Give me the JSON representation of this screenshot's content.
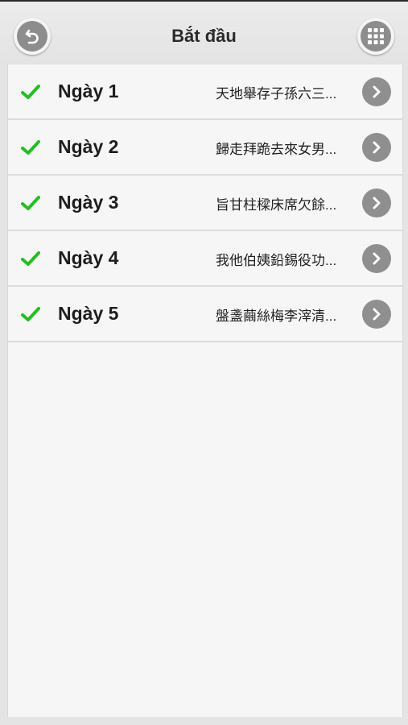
{
  "header": {
    "title": "Bắt đầu",
    "back_icon": "undo-arrow-icon",
    "menu_icon": "grid-icon"
  },
  "colors": {
    "check": "#22c022",
    "chevron_bg": "#8f8f8f"
  },
  "days": [
    {
      "label": "Ngày 1",
      "preview": "天地舉存子孫六三...",
      "completed": true
    },
    {
      "label": "Ngày 2",
      "preview": "歸走拜跪去來女男...",
      "completed": true
    },
    {
      "label": "Ngày 3",
      "preview": "旨甘柱樑床席欠餘...",
      "completed": true
    },
    {
      "label": "Ngày 4",
      "preview": "我他伯姨鉛錫役功...",
      "completed": true
    },
    {
      "label": "Ngày 5",
      "preview": "盤盞繭絲梅李滓清...",
      "completed": true
    }
  ]
}
